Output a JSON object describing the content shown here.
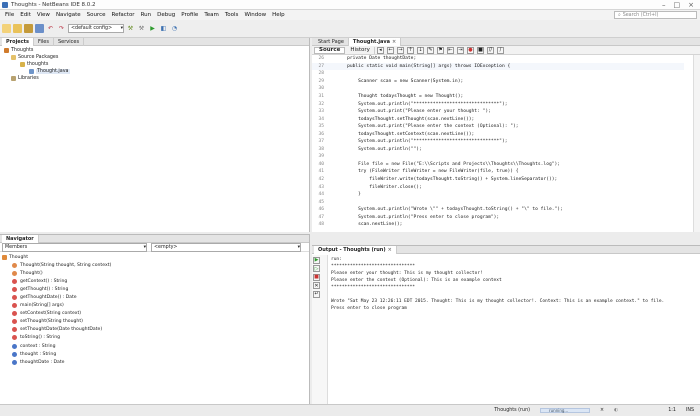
{
  "titlebar": {
    "title": "Thoughts - NetBeans IDE 8.0.2"
  },
  "menubar": {
    "items": [
      "File",
      "Edit",
      "View",
      "Navigate",
      "Source",
      "Refactor",
      "Run",
      "Debug",
      "Profile",
      "Team",
      "Tools",
      "Window",
      "Help"
    ],
    "search_placeholder": "Search (Ctrl+I)"
  },
  "toolbar": {
    "config": "<default config>"
  },
  "projects": {
    "tabs": [
      "Projects",
      "Files",
      "Services"
    ],
    "tree": [
      {
        "label": "Thoughts",
        "depth": 0,
        "icon": "coffee-cup-icon"
      },
      {
        "label": "Source Packages",
        "depth": 1,
        "icon": "folder-icon"
      },
      {
        "label": "thoughts",
        "depth": 2,
        "icon": "package-icon"
      },
      {
        "label": "Thought.java",
        "depth": 3,
        "icon": "java-file-icon"
      },
      {
        "label": "Libraries",
        "depth": 1,
        "icon": "library-icon"
      }
    ]
  },
  "editor": {
    "tabs": [
      "Start Page",
      "Thought.java"
    ],
    "subtabs": [
      "Source",
      "History"
    ],
    "lines": [
      {
        "n": "26",
        "t": "    private Date thoughtDate;"
      },
      {
        "n": "27",
        "t": "    public static void main(String[] args) throws IOException {"
      },
      {
        "n": "28",
        "t": ""
      },
      {
        "n": "29",
        "t": "        Scanner scan = new Scanner(System.in);"
      },
      {
        "n": "30",
        "t": ""
      },
      {
        "n": "31",
        "t": "        Thought todaysThought = new Thought();"
      },
      {
        "n": "32",
        "t": "        System.out.println(\"*******************************\");"
      },
      {
        "n": "33",
        "t": "        System.out.print(\"Please enter your thought: \");"
      },
      {
        "n": "34",
        "t": "        todaysThought.setThought(scan.nextLine());"
      },
      {
        "n": "35",
        "t": "        System.out.print(\"Please enter the context (Optional): \");"
      },
      {
        "n": "36",
        "t": "        todaysThought.setContext(scan.nextLine());"
      },
      {
        "n": "37",
        "t": "        System.out.println(\"*******************************\");"
      },
      {
        "n": "38",
        "t": "        System.out.println(\"\");"
      },
      {
        "n": "39",
        "t": ""
      },
      {
        "n": "40",
        "t": "        File file = new File(\"E:\\\\Scripts and Projects\\\\Thoughts\\\\Thoughts.log\");"
      },
      {
        "n": "41",
        "t": "        try (FileWriter fileWriter = new FileWriter(file, true)) {"
      },
      {
        "n": "42",
        "t": "            fileWriter.write(todaysThought.toString() + System.lineSeparator());"
      },
      {
        "n": "43",
        "t": "            fileWriter.close();"
      },
      {
        "n": "44",
        "t": "        }"
      },
      {
        "n": "45",
        "t": ""
      },
      {
        "n": "46",
        "t": "        System.out.println(\"Wrote \\\"\" + todaysThought.toString() + \"\\\" to file.\");"
      },
      {
        "n": "47",
        "t": "        System.out.println(\"Press enter to close program\");"
      },
      {
        "n": "48",
        "t": "        scan.nextLine();"
      }
    ]
  },
  "navigator": {
    "title": "Navigator",
    "filter": "Members",
    "filter2": "<empty>",
    "root": "Thought",
    "items": [
      {
        "label": "Thought(String thought, String context)",
        "kind": "ctor"
      },
      {
        "label": "Thought()",
        "kind": "ctor"
      },
      {
        "label": "getContext() : String",
        "kind": "method"
      },
      {
        "label": "getThought() : String",
        "kind": "method"
      },
      {
        "label": "getThoughtDate() : Date",
        "kind": "method"
      },
      {
        "label": "main(String[] args)",
        "kind": "method"
      },
      {
        "label": "setContext(String context)",
        "kind": "method"
      },
      {
        "label": "setThought(String thought)",
        "kind": "method"
      },
      {
        "label": "setThoughtDate(Date thoughtDate)",
        "kind": "method"
      },
      {
        "label": "toString() : String",
        "kind": "method"
      },
      {
        "label": "context : String",
        "kind": "field"
      },
      {
        "label": "thought : String",
        "kind": "field"
      },
      {
        "label": "thoughtDate : Date",
        "kind": "field"
      }
    ]
  },
  "output": {
    "title": "Output - Thoughts (run)",
    "lines": [
      "run:",
      "*******************************",
      "Please enter your thought: This is my thought collector!",
      "Please enter the context (Optional): This is an example context",
      "*******************************",
      "",
      "Wrote \"Sat May 23 12:26:11 EDT 2015. Thought: This is my thought collector!. Context: This is an example context.\" to file.",
      "Press enter to close program"
    ]
  },
  "statusbar": {
    "task": "Thoughts (run)",
    "status": "running...",
    "position": "1:1",
    "mode": "INS"
  },
  "colors": {
    "accent": "#3b6fb6",
    "string": "#ce7b00",
    "keyword": "#0000e6"
  }
}
